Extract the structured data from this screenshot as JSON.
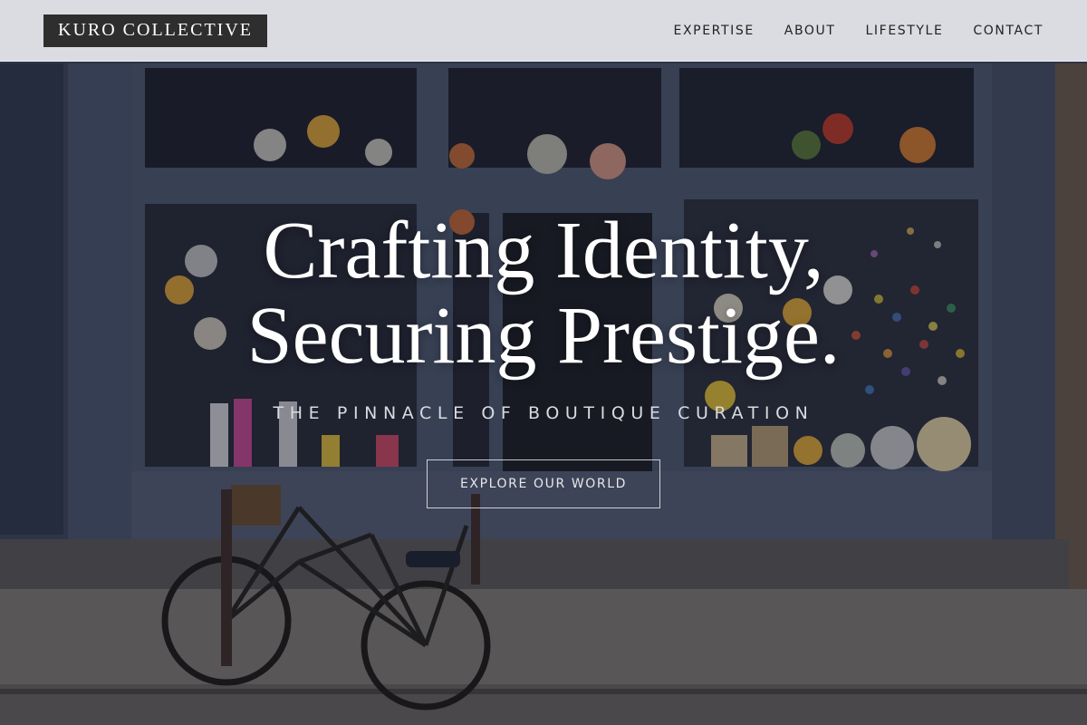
{
  "brand": {
    "logo_text": "KURO COLLECTIVE"
  },
  "nav": {
    "items": [
      {
        "label": "EXPERTISE"
      },
      {
        "label": "ABOUT"
      },
      {
        "label": "LIFESTYLE"
      },
      {
        "label": "CONTACT"
      }
    ]
  },
  "hero": {
    "headline_line1": "Crafting Identity,",
    "headline_line2": "Securing Prestige.",
    "tagline": "THE PINNACLE OF BOUTIQUE CURATION",
    "cta_label": "EXPLORE OUR WORLD",
    "background_image": "storefront-with-bicycle"
  },
  "colors": {
    "header_bg": "#E8EAEE",
    "logo_bg": "#2E2E2E",
    "text_white": "#FFFFFF",
    "storefront_blue": "#4A5670"
  }
}
